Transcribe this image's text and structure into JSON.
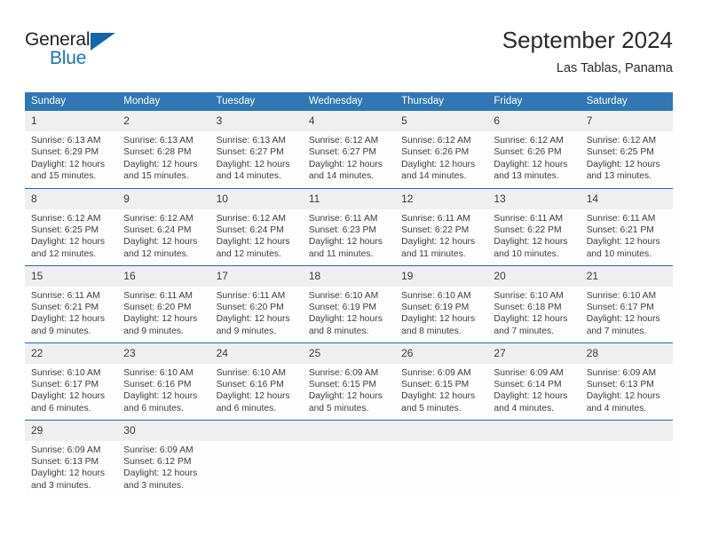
{
  "brand": {
    "logo_primary": "General",
    "logo_secondary": "Blue",
    "logo_icon": "blue-triangle",
    "accent_color": "#1f73b7",
    "header_color": "#3077b4",
    "daynum_bg": "#efeff0"
  },
  "header": {
    "title": "September 2024",
    "subtitle": "Las Tablas, Panama"
  },
  "calendar": {
    "weekday_headers": [
      "Sunday",
      "Monday",
      "Tuesday",
      "Wednesday",
      "Thursday",
      "Friday",
      "Saturday"
    ],
    "labels": {
      "sunrise": "Sunrise:",
      "sunset": "Sunset:",
      "daylight": "Daylight:"
    },
    "weeks": [
      [
        {
          "day": "1",
          "sunrise": "Sunrise: 6:13 AM",
          "sunset": "Sunset: 6:29 PM",
          "daylight_1": "Daylight: 12 hours",
          "daylight_2": "and 15 minutes."
        },
        {
          "day": "2",
          "sunrise": "Sunrise: 6:13 AM",
          "sunset": "Sunset: 6:28 PM",
          "daylight_1": "Daylight: 12 hours",
          "daylight_2": "and 15 minutes."
        },
        {
          "day": "3",
          "sunrise": "Sunrise: 6:13 AM",
          "sunset": "Sunset: 6:27 PM",
          "daylight_1": "Daylight: 12 hours",
          "daylight_2": "and 14 minutes."
        },
        {
          "day": "4",
          "sunrise": "Sunrise: 6:12 AM",
          "sunset": "Sunset: 6:27 PM",
          "daylight_1": "Daylight: 12 hours",
          "daylight_2": "and 14 minutes."
        },
        {
          "day": "5",
          "sunrise": "Sunrise: 6:12 AM",
          "sunset": "Sunset: 6:26 PM",
          "daylight_1": "Daylight: 12 hours",
          "daylight_2": "and 14 minutes."
        },
        {
          "day": "6",
          "sunrise": "Sunrise: 6:12 AM",
          "sunset": "Sunset: 6:26 PM",
          "daylight_1": "Daylight: 12 hours",
          "daylight_2": "and 13 minutes."
        },
        {
          "day": "7",
          "sunrise": "Sunrise: 6:12 AM",
          "sunset": "Sunset: 6:25 PM",
          "daylight_1": "Daylight: 12 hours",
          "daylight_2": "and 13 minutes."
        }
      ],
      [
        {
          "day": "8",
          "sunrise": "Sunrise: 6:12 AM",
          "sunset": "Sunset: 6:25 PM",
          "daylight_1": "Daylight: 12 hours",
          "daylight_2": "and 12 minutes."
        },
        {
          "day": "9",
          "sunrise": "Sunrise: 6:12 AM",
          "sunset": "Sunset: 6:24 PM",
          "daylight_1": "Daylight: 12 hours",
          "daylight_2": "and 12 minutes."
        },
        {
          "day": "10",
          "sunrise": "Sunrise: 6:12 AM",
          "sunset": "Sunset: 6:24 PM",
          "daylight_1": "Daylight: 12 hours",
          "daylight_2": "and 12 minutes."
        },
        {
          "day": "11",
          "sunrise": "Sunrise: 6:11 AM",
          "sunset": "Sunset: 6:23 PM",
          "daylight_1": "Daylight: 12 hours",
          "daylight_2": "and 11 minutes."
        },
        {
          "day": "12",
          "sunrise": "Sunrise: 6:11 AM",
          "sunset": "Sunset: 6:22 PM",
          "daylight_1": "Daylight: 12 hours",
          "daylight_2": "and 11 minutes."
        },
        {
          "day": "13",
          "sunrise": "Sunrise: 6:11 AM",
          "sunset": "Sunset: 6:22 PM",
          "daylight_1": "Daylight: 12 hours",
          "daylight_2": "and 10 minutes."
        },
        {
          "day": "14",
          "sunrise": "Sunrise: 6:11 AM",
          "sunset": "Sunset: 6:21 PM",
          "daylight_1": "Daylight: 12 hours",
          "daylight_2": "and 10 minutes."
        }
      ],
      [
        {
          "day": "15",
          "sunrise": "Sunrise: 6:11 AM",
          "sunset": "Sunset: 6:21 PM",
          "daylight_1": "Daylight: 12 hours",
          "daylight_2": "and 9 minutes."
        },
        {
          "day": "16",
          "sunrise": "Sunrise: 6:11 AM",
          "sunset": "Sunset: 6:20 PM",
          "daylight_1": "Daylight: 12 hours",
          "daylight_2": "and 9 minutes."
        },
        {
          "day": "17",
          "sunrise": "Sunrise: 6:11 AM",
          "sunset": "Sunset: 6:20 PM",
          "daylight_1": "Daylight: 12 hours",
          "daylight_2": "and 9 minutes."
        },
        {
          "day": "18",
          "sunrise": "Sunrise: 6:10 AM",
          "sunset": "Sunset: 6:19 PM",
          "daylight_1": "Daylight: 12 hours",
          "daylight_2": "and 8 minutes."
        },
        {
          "day": "19",
          "sunrise": "Sunrise: 6:10 AM",
          "sunset": "Sunset: 6:19 PM",
          "daylight_1": "Daylight: 12 hours",
          "daylight_2": "and 8 minutes."
        },
        {
          "day": "20",
          "sunrise": "Sunrise: 6:10 AM",
          "sunset": "Sunset: 6:18 PM",
          "daylight_1": "Daylight: 12 hours",
          "daylight_2": "and 7 minutes."
        },
        {
          "day": "21",
          "sunrise": "Sunrise: 6:10 AM",
          "sunset": "Sunset: 6:17 PM",
          "daylight_1": "Daylight: 12 hours",
          "daylight_2": "and 7 minutes."
        }
      ],
      [
        {
          "day": "22",
          "sunrise": "Sunrise: 6:10 AM",
          "sunset": "Sunset: 6:17 PM",
          "daylight_1": "Daylight: 12 hours",
          "daylight_2": "and 6 minutes."
        },
        {
          "day": "23",
          "sunrise": "Sunrise: 6:10 AM",
          "sunset": "Sunset: 6:16 PM",
          "daylight_1": "Daylight: 12 hours",
          "daylight_2": "and 6 minutes."
        },
        {
          "day": "24",
          "sunrise": "Sunrise: 6:10 AM",
          "sunset": "Sunset: 6:16 PM",
          "daylight_1": "Daylight: 12 hours",
          "daylight_2": "and 6 minutes."
        },
        {
          "day": "25",
          "sunrise": "Sunrise: 6:09 AM",
          "sunset": "Sunset: 6:15 PM",
          "daylight_1": "Daylight: 12 hours",
          "daylight_2": "and 5 minutes."
        },
        {
          "day": "26",
          "sunrise": "Sunrise: 6:09 AM",
          "sunset": "Sunset: 6:15 PM",
          "daylight_1": "Daylight: 12 hours",
          "daylight_2": "and 5 minutes."
        },
        {
          "day": "27",
          "sunrise": "Sunrise: 6:09 AM",
          "sunset": "Sunset: 6:14 PM",
          "daylight_1": "Daylight: 12 hours",
          "daylight_2": "and 4 minutes."
        },
        {
          "day": "28",
          "sunrise": "Sunrise: 6:09 AM",
          "sunset": "Sunset: 6:13 PM",
          "daylight_1": "Daylight: 12 hours",
          "daylight_2": "and 4 minutes."
        }
      ],
      [
        {
          "day": "29",
          "sunrise": "Sunrise: 6:09 AM",
          "sunset": "Sunset: 6:13 PM",
          "daylight_1": "Daylight: 12 hours",
          "daylight_2": "and 3 minutes."
        },
        {
          "day": "30",
          "sunrise": "Sunrise: 6:09 AM",
          "sunset": "Sunset: 6:12 PM",
          "daylight_1": "Daylight: 12 hours",
          "daylight_2": "and 3 minutes."
        },
        {
          "day": "",
          "sunrise": "",
          "sunset": "",
          "daylight_1": "",
          "daylight_2": ""
        },
        {
          "day": "",
          "sunrise": "",
          "sunset": "",
          "daylight_1": "",
          "daylight_2": ""
        },
        {
          "day": "",
          "sunrise": "",
          "sunset": "",
          "daylight_1": "",
          "daylight_2": ""
        },
        {
          "day": "",
          "sunrise": "",
          "sunset": "",
          "daylight_1": "",
          "daylight_2": ""
        },
        {
          "day": "",
          "sunrise": "",
          "sunset": "",
          "daylight_1": "",
          "daylight_2": ""
        }
      ]
    ]
  }
}
